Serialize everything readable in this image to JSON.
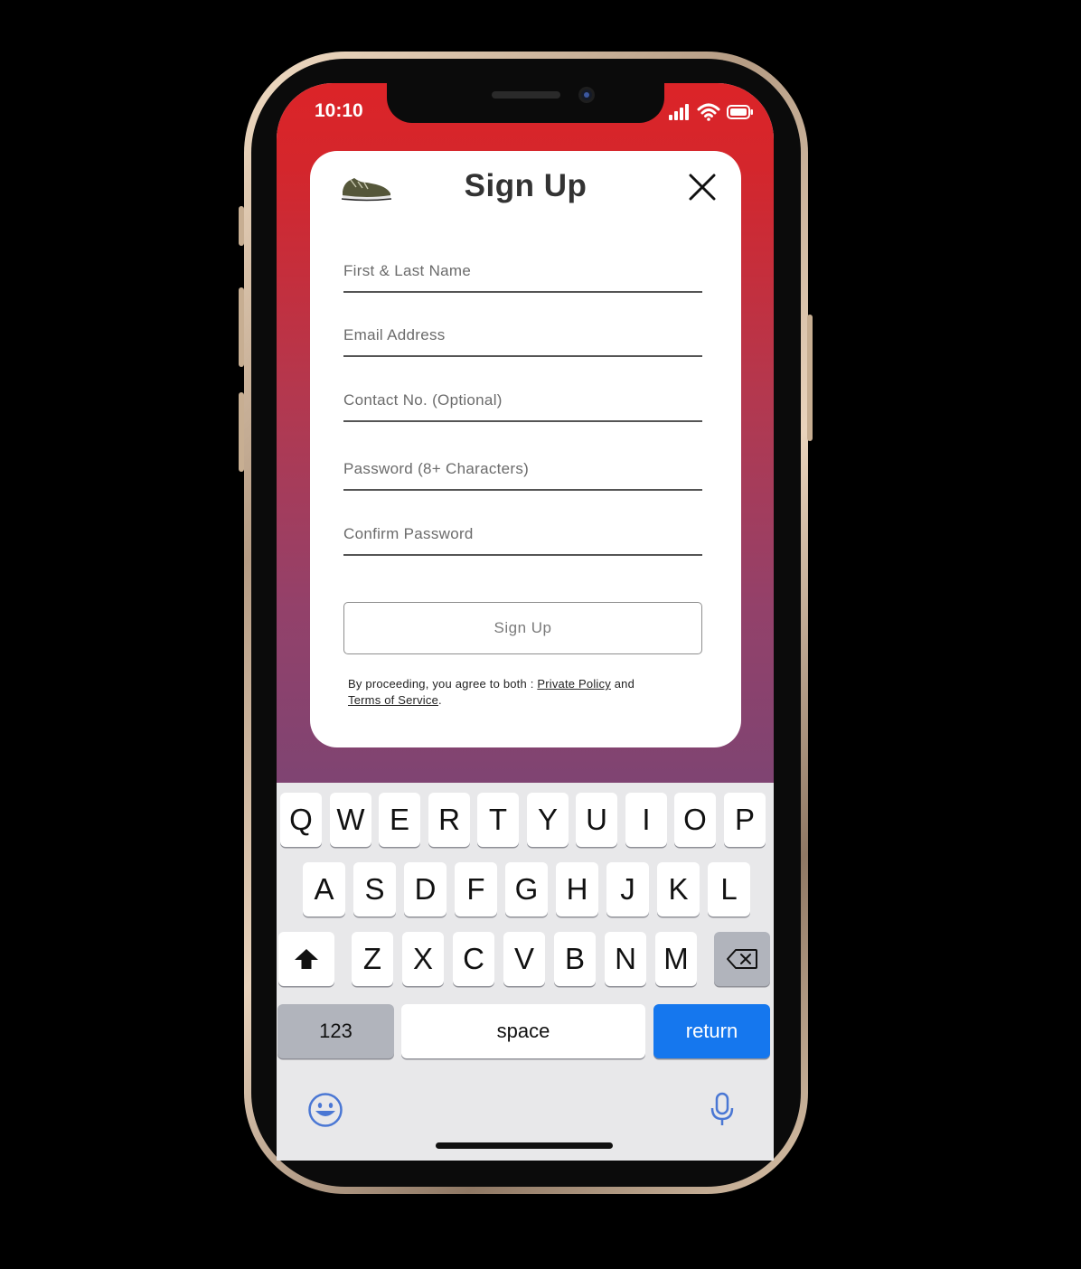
{
  "status_bar": {
    "time": "10:10"
  },
  "card": {
    "title": "Sign Up",
    "fields": [
      {
        "placeholder": "First & Last Name",
        "value": ""
      },
      {
        "placeholder": "Email Address",
        "value": ""
      },
      {
        "placeholder": "Contact No. (Optional)",
        "value": ""
      },
      {
        "placeholder": "Password (8+ Characters)",
        "value": ""
      },
      {
        "placeholder": "Confirm Password",
        "value": ""
      }
    ],
    "signup_button": "Sign Up",
    "terms": {
      "prefix": "By proceeding, you agree to both : ",
      "privacy_link": "Private Policy",
      "middle": " and",
      "tos_link": "Terms of Service",
      "suffix": "."
    }
  },
  "keyboard": {
    "row1": [
      "Q",
      "W",
      "E",
      "R",
      "T",
      "Y",
      "U",
      "I",
      "O",
      "P"
    ],
    "row2": [
      "A",
      "S",
      "D",
      "F",
      "G",
      "H",
      "J",
      "K",
      "L"
    ],
    "row3": [
      "Z",
      "X",
      "C",
      "V",
      "B",
      "N",
      "M"
    ],
    "numbers_key": "123",
    "space_key": "space",
    "return_key": "return"
  },
  "colors": {
    "gradient_top": "#dc2428",
    "gradient_bottom": "#7f4472",
    "return_key": "#1577ee",
    "emoji_mic": "#4a77d4"
  }
}
